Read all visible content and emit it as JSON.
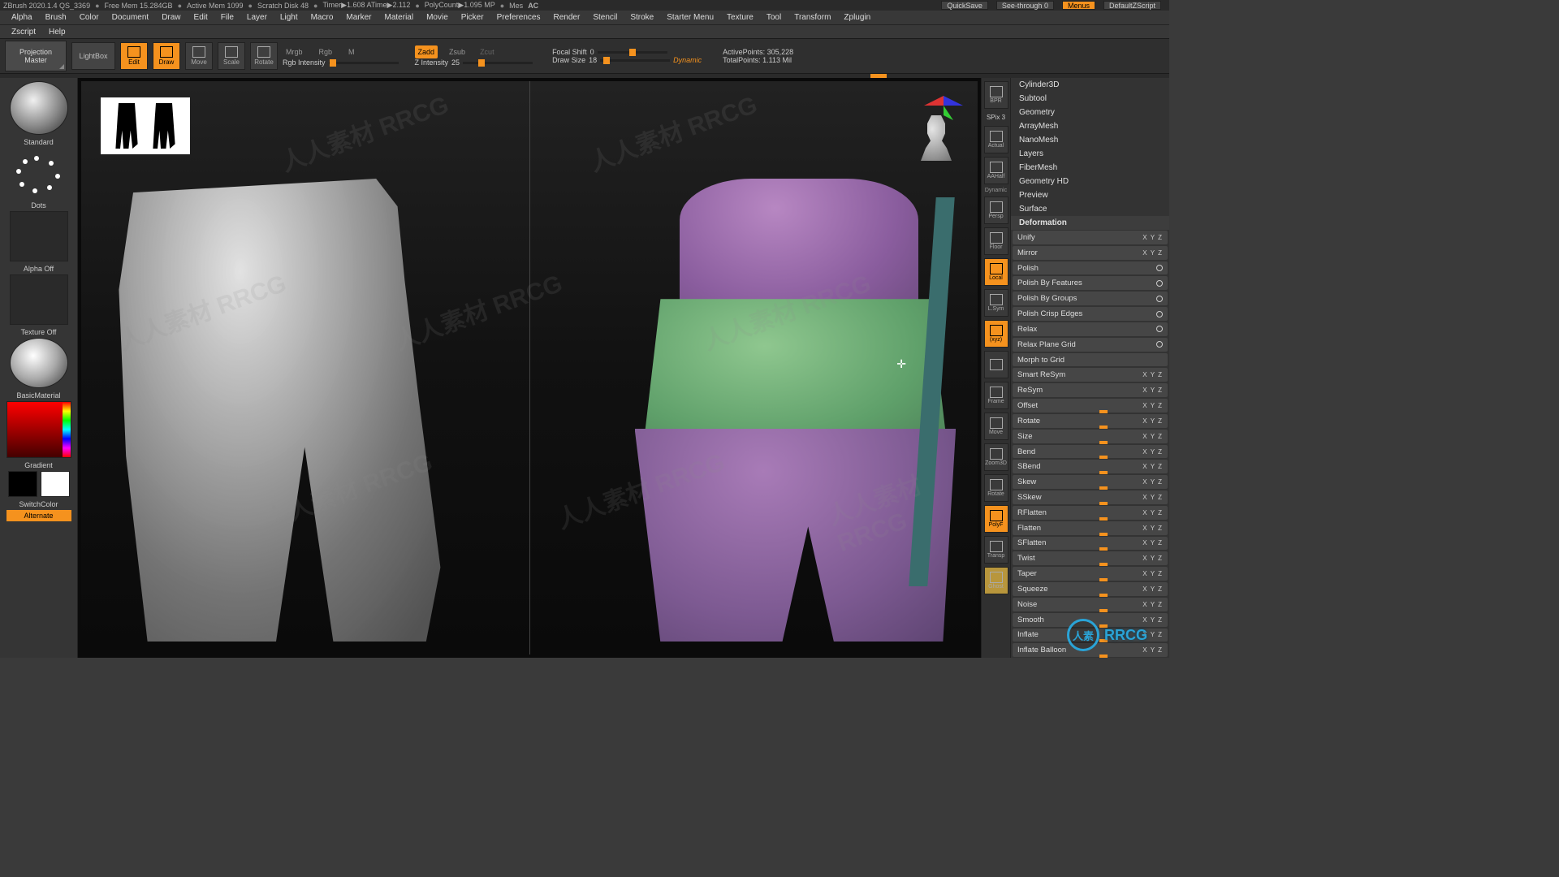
{
  "title": {
    "app": "ZBrush 2020.1.4 QS_3369",
    "freemem": "Free Mem 15.284GB",
    "activemem": "Active Mem 1099",
    "scratch": "Scratch Disk 48",
    "timer": "Timer▶1.608 ATime▶2.112",
    "polycount": "PolyCount▶1.095 MP",
    "mes": "Mes",
    "ac": "AC",
    "quicksave": "QuickSave",
    "seethrough": "See-through  0",
    "menus": "Menus",
    "defaultzscript": "DefaultZScript"
  },
  "menubar": [
    "Alpha",
    "Brush",
    "Color",
    "Document",
    "Draw",
    "Edit",
    "File",
    "Layer",
    "Light",
    "Macro",
    "Marker",
    "Material",
    "Movie",
    "Picker",
    "Preferences",
    "Render",
    "Stencil",
    "Stroke",
    "Starter Menu",
    "Texture",
    "Tool",
    "Transform",
    "Zplugin"
  ],
  "menubar2": [
    "Zscript",
    "Help"
  ],
  "toolbar": {
    "projection": "Projection\nMaster",
    "lightbox": "LightBox",
    "modes": {
      "edit": "Edit",
      "draw": "Draw",
      "move": "Move",
      "scale": "Scale",
      "rotate": "Rotate"
    },
    "rgb": {
      "mrgb": "Mrgb",
      "rgb": "Rgb",
      "m": "M",
      "intensity_label": "Rgb Intensity"
    },
    "z": {
      "zadd": "Zadd",
      "zsub": "Zsub",
      "zcut": "Zcut",
      "zintensity_label": "Z Intensity",
      "zintensity_val": "25"
    },
    "focal": {
      "label": "Focal Shift",
      "val": "0"
    },
    "drawsize": {
      "label": "Draw Size",
      "val": "18"
    },
    "dynamic": "Dynamic",
    "activepoints": {
      "label": "ActivePoints:",
      "val": "305,228"
    },
    "totalpoints": {
      "label": "TotalPoints:",
      "val": "1.113 Mil"
    }
  },
  "left": {
    "brush": "Standard",
    "stroke": "Dots",
    "alpha": "Alpha Off",
    "texture": "Texture Off",
    "material": "BasicMaterial",
    "gradient": "Gradient",
    "switchcolor": "SwitchColor",
    "alternate": "Alternate"
  },
  "rightbtns": [
    {
      "label": "BPR",
      "on": false
    },
    {
      "label": "SPix 3",
      "on": false,
      "thin": true
    },
    {
      "label": "Actual",
      "on": false
    },
    {
      "label": "AAHalf",
      "on": false
    },
    {
      "label": "Persp",
      "on": false,
      "sub": "Dynamic"
    },
    {
      "label": "Floor",
      "on": false
    },
    {
      "label": "Local",
      "on": true
    },
    {
      "label": "L.Sym",
      "on": false
    },
    {
      "label": "(xyz)",
      "on": true
    },
    {
      "label": "",
      "on": false
    },
    {
      "label": "Frame",
      "on": false
    },
    {
      "label": "Move",
      "on": false
    },
    {
      "label": "Zoom3D",
      "on": false
    },
    {
      "label": "Rotate",
      "on": false
    },
    {
      "label": "PolyF",
      "on": true
    },
    {
      "label": "Transp",
      "on": false
    },
    {
      "label": "Ghost",
      "on": false,
      "gold": true
    }
  ],
  "rightpanel": {
    "tool_sections": [
      "Cylinder3D",
      "Subtool",
      "Geometry",
      "ArrayMesh",
      "NanoMesh",
      "Layers",
      "FiberMesh",
      "Geometry HD",
      "Preview",
      "Surface"
    ],
    "deformation_header": "Deformation",
    "def_items": [
      {
        "name": "Unify",
        "ctrl": "xyz"
      },
      {
        "name": "Mirror",
        "ctrl": "xyz"
      },
      {
        "name": "Polish",
        "ctrl": "circle"
      },
      {
        "name": "Polish By Features",
        "ctrl": "circle"
      },
      {
        "name": "Polish By Groups",
        "ctrl": "circle"
      },
      {
        "name": "Polish Crisp Edges",
        "ctrl": "circle"
      },
      {
        "name": "Relax",
        "ctrl": "circle"
      },
      {
        "name": "Relax Plane Grid",
        "ctrl": "circle"
      },
      {
        "name": "Morph to Grid",
        "ctrl": ""
      },
      {
        "name": "Smart ReSym",
        "ctrl": "xyz"
      },
      {
        "name": "ReSym",
        "ctrl": "xyz"
      },
      {
        "name": "Offset",
        "ctrl": "xyz",
        "slider": true
      },
      {
        "name": "Rotate",
        "ctrl": "xyz",
        "slider": true
      },
      {
        "name": "Size",
        "ctrl": "xyz",
        "slider": true
      },
      {
        "name": "Bend",
        "ctrl": "xyz",
        "slider": true
      },
      {
        "name": "SBend",
        "ctrl": "xyz",
        "slider": true
      },
      {
        "name": "Skew",
        "ctrl": "xyz",
        "slider": true
      },
      {
        "name": "SSkew",
        "ctrl": "xyz",
        "slider": true
      },
      {
        "name": "RFlatten",
        "ctrl": "xyz",
        "slider": true
      },
      {
        "name": "Flatten",
        "ctrl": "xyz",
        "slider": true
      },
      {
        "name": "SFlatten",
        "ctrl": "xyz",
        "slider": true
      },
      {
        "name": "Twist",
        "ctrl": "xyz",
        "slider": true
      },
      {
        "name": "Taper",
        "ctrl": "xyz",
        "slider": true
      },
      {
        "name": "Squeeze",
        "ctrl": "xyz",
        "slider": true
      },
      {
        "name": "Noise",
        "ctrl": "xyz",
        "slider": true
      },
      {
        "name": "Smooth",
        "ctrl": "xyz",
        "slider": true
      },
      {
        "name": "Inflate",
        "ctrl": "xyz",
        "slider": true
      },
      {
        "name": "Inflate Balloon",
        "ctrl": "xyz",
        "slider": true
      }
    ]
  },
  "watermark": {
    "text": "人人素材 RRCG",
    "brand": "RRCG"
  }
}
